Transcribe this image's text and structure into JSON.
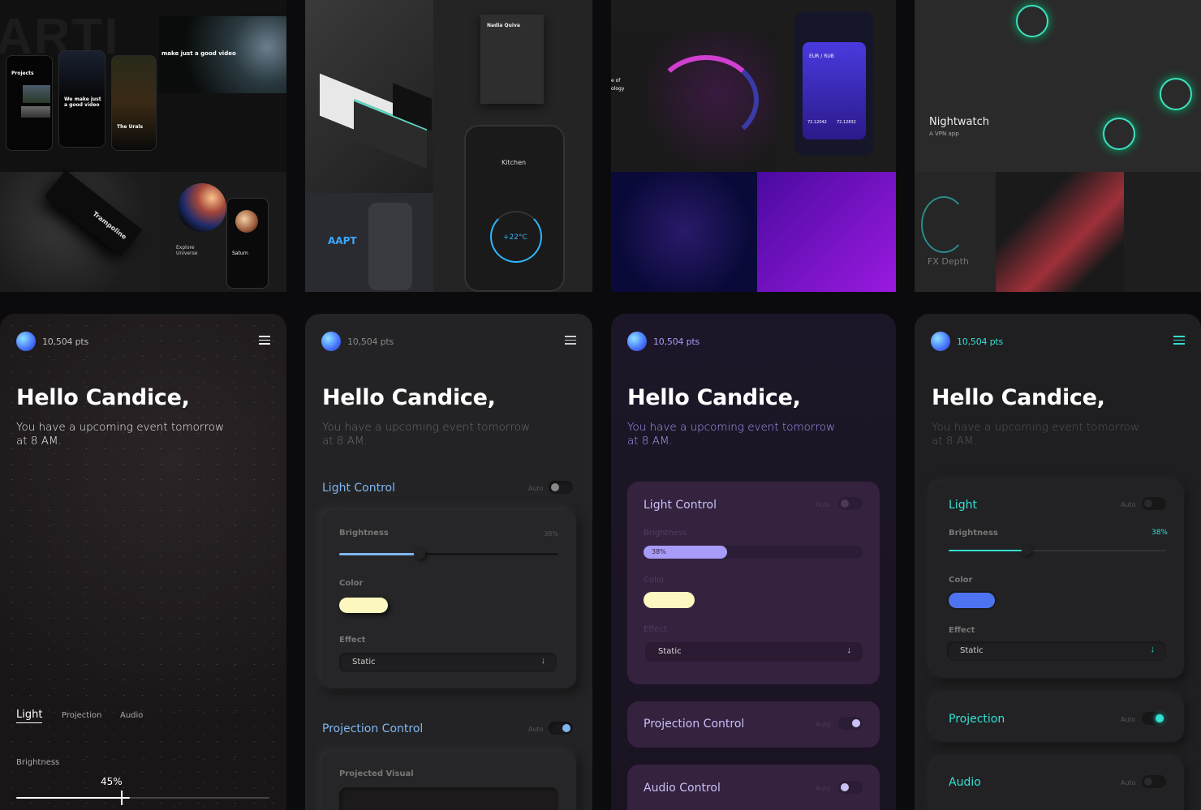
{
  "gallery": {
    "t1": {
      "hero": "make just a good video",
      "projects": "Projects",
      "phone_text": "We make just a good video",
      "urals": "The Urals",
      "explore": "Explore Universe",
      "saturn": "Saturn",
      "product": "Trampoline"
    },
    "t2": {
      "resume_name": "Nadia Quiva",
      "kitchen": "Kitchen",
      "temp": "+22°C",
      "brand": "AAPT"
    },
    "t3": {
      "pair": "EUR / RUB",
      "rate1": "72.12042",
      "rate2": "72.12832",
      "text1": "e of",
      "text2": "ology"
    },
    "t4": {
      "app_name": "Nightwatch",
      "app_desc": "A VPN app",
      "knob_label": "FX Depth"
    }
  },
  "cards": [
    {
      "points": "10,504 pts",
      "greeting": "Hello Candice,",
      "subtitle": "You have a upcoming event tomorrow at 8 AM.",
      "tabs": [
        "Light",
        "Projection",
        "Audio"
      ],
      "active_tab": "Light",
      "brightness_label": "Brightness",
      "brightness_value": "45%",
      "brightness_level": 0.45,
      "colors": {
        "bg": "#1e1a1b",
        "accent": "#ffffff"
      }
    },
    {
      "points": "10,504 pts",
      "greeting": "Hello Candice,",
      "subtitle": "You have a upcoming event tomorrow at 8 AM.",
      "light_title": "Light Control",
      "auto": "Auto",
      "brightness_label": "Brightness",
      "brightness_value": "38%",
      "brightness_level": 0.38,
      "color_label": "Color",
      "effect_label": "Effect",
      "effect_value": "Static",
      "projection_title": "Projection Control",
      "projected_label": "Projected Visual",
      "colors": {
        "bg": "#232325",
        "accent": "#7fb6f0",
        "swatch": "#fbf7be"
      }
    },
    {
      "points": "10,504 pts",
      "greeting": "Hello Candice,",
      "subtitle": "You have a upcoming event tomorrow at 8 AM.",
      "light_title": "Light Control",
      "auto": "Auto",
      "brightness_label": "Brightness",
      "brightness_value": "38%",
      "brightness_level": 0.38,
      "color_label": "Color",
      "effect_label": "Effect",
      "effect_value": "Static",
      "projection_title": "Projection Control",
      "audio_title": "Audio Control",
      "colors": {
        "bg": "#1b1424",
        "accent": "#a79cf7",
        "swatch": "#fff7c2",
        "panel": "#34223f"
      }
    },
    {
      "points": "10,504 pts",
      "greeting": "Hello Candice,",
      "subtitle": "You have a upcoming event tomorrow at 8 AM.",
      "light_title": "Light",
      "auto": "Auto",
      "brightness_label": "Brightness",
      "brightness_value": "38%",
      "brightness_level": 0.38,
      "color_label": "Color",
      "effect_label": "Effect",
      "effect_value": "Static",
      "projection_title": "Projection",
      "audio_title": "Audio",
      "colors": {
        "bg": "#1f1f21",
        "accent": "#33e0d3",
        "swatch": "#4e73f0"
      }
    }
  ]
}
